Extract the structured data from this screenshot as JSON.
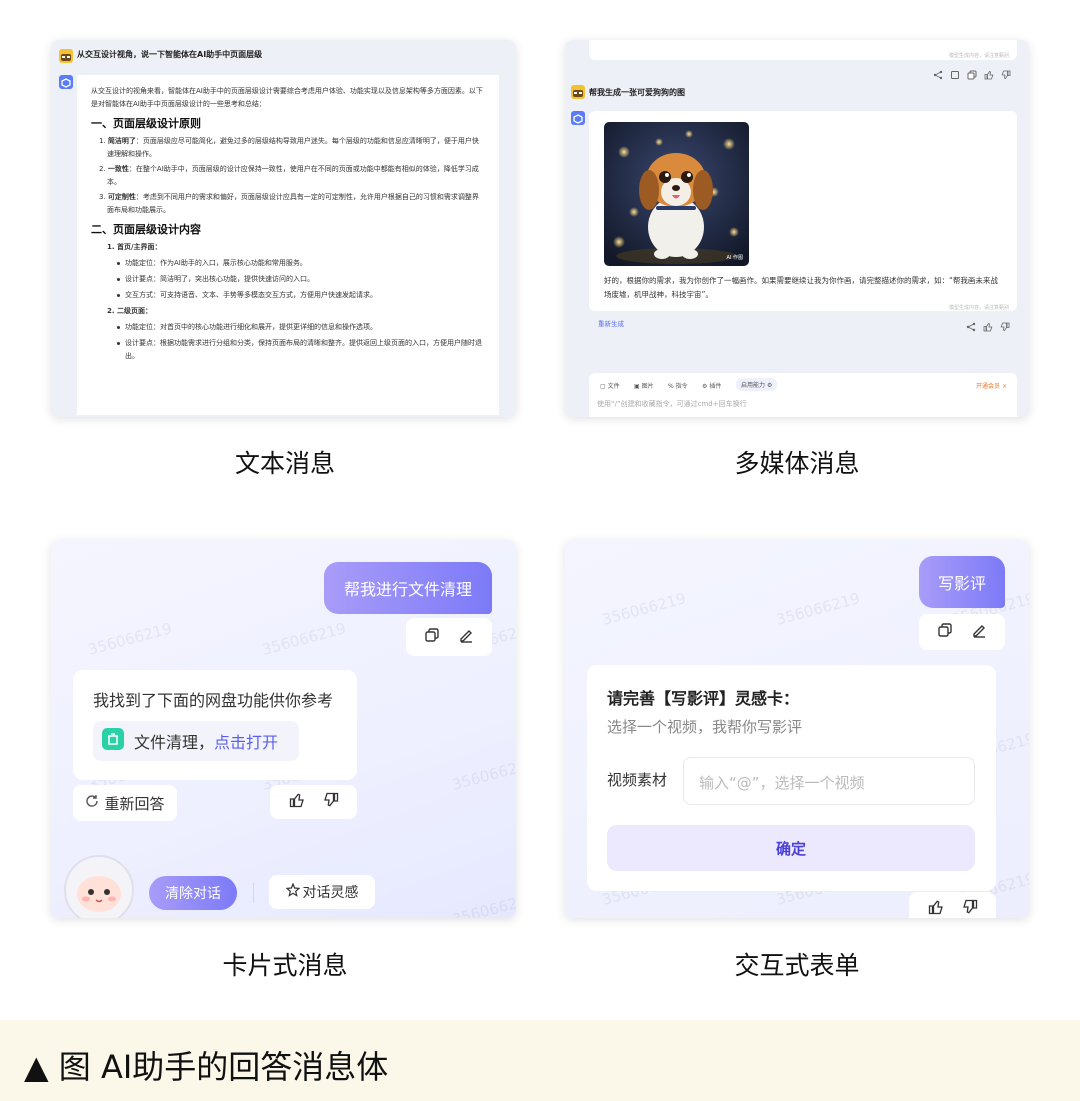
{
  "panel1": {
    "question": "从交互设计视角，说一下智能体在AI助手中页面层级",
    "intro": "从交互设计的视角来看，智能体在AI助手中的页面层级设计需要综合考虑用户体验、功能实现以及信息架构等多方面因素。以下是对智能体在AI助手中页面层级设计的一些思考和总结：",
    "h1": "一、页面层级设计原则",
    "principles": [
      {
        "num": "1.",
        "title": "简洁明了",
        "text": "：页面层级应尽可能简化，避免过多的层级结构导致用户迷失。每个层级的功能和信息应清晰明了，便于用户快速理解和操作。"
      },
      {
        "num": "2.",
        "title": "一致性",
        "text": "：在整个AI助手中，页面层级的设计应保持一致性，使用户在不同的页面或功能中都能有相似的体验，降低学习成本。"
      },
      {
        "num": "3.",
        "title": "可定制性",
        "text": "：考虑到不同用户的需求和偏好，页面层级设计应具有一定的可定制性，允许用户根据自己的习惯和需求调整界面布局和功能展示。"
      }
    ],
    "h2": "二、页面层级设计内容",
    "sub1": "1. 首页/主界面：",
    "sub1_items": [
      "功能定位：作为AI助手的入口，展示核心功能和常用服务。",
      "设计要点：简洁明了，突出核心功能，提供快速访问的入口。",
      "交互方式：可支持语音、文本、手势等多模态交互方式，方便用户快速发起请求。"
    ],
    "sub2": "2. 二级页面：",
    "sub2_items": [
      "功能定位：对首页中的核心功能进行细化和展开，提供更详细的信息和操作选项。",
      "设计要点：根据功能需求进行分组和分类，保持页面布局的清晰和整齐。提供返回上级页面的入口，方便用户随时退出。"
    ]
  },
  "panel2": {
    "top_note": "模型生成内容，请注意甄别",
    "question": "帮我生成一张可爱狗狗的图",
    "image_badge": "AI 作图",
    "reply": "好的，根据你的需求，我为你创作了一幅画作。如果需要继续让我为你作画，请完整描述你的需求，如：“帮我画未来战场废墟，机甲战神，科技宇宙”。",
    "note2": "模型生成内容，请注意甄别",
    "regenerate": "重新生成",
    "tools": [
      "文件",
      "图片",
      "指令",
      "插件",
      "启用能力"
    ],
    "vip": "开通会员",
    "placeholder": "使用“/”创建和收藏指令，可通过cmd+回车换行"
  },
  "panel3": {
    "watermark": "356066219",
    "user_msg": "帮我进行文件清理",
    "reply": "我找到了下面的网盘功能供你参考",
    "link_text": "文件清理，",
    "link_action": "点击打开",
    "retry": "重新回答",
    "clear": "清除对话",
    "inspire": "对话灵感"
  },
  "panel4": {
    "watermark": "356066219",
    "user_msg": "写影评",
    "form_title": "请完善【写影评】灵感卡：",
    "form_sub": "选择一个视频，我帮你写影评",
    "field_label": "视频素材",
    "field_placeholder": "输入“@”，选择一个视频",
    "confirm": "确定"
  },
  "captions": {
    "c1": "文本消息",
    "c2": "多媒体消息",
    "c3": "卡片式消息",
    "c4": "交互式表单"
  },
  "figure_caption": "▲ 图 AI助手的回答消息体"
}
